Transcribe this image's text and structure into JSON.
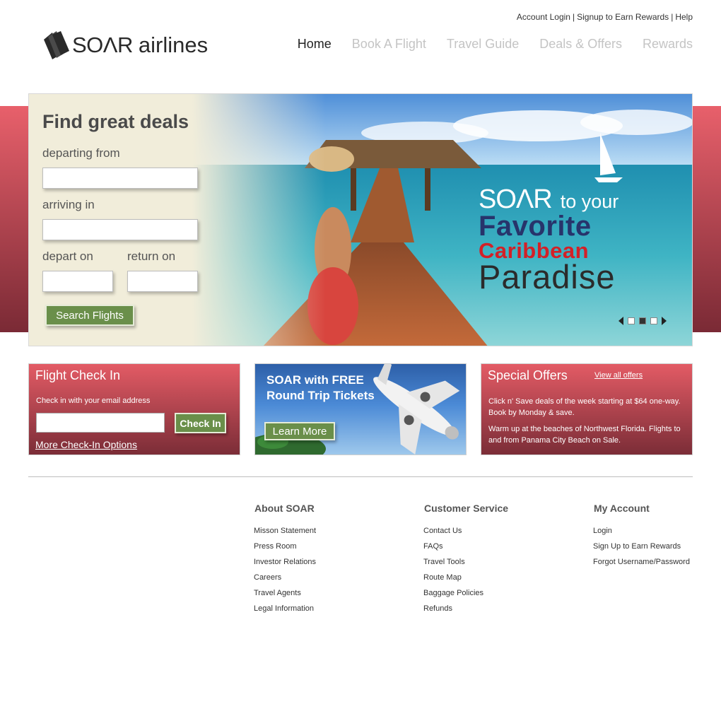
{
  "header": {
    "top_links": [
      "Account Login",
      "Signup to Earn Rewards",
      "Help"
    ],
    "logo": {
      "soar": "SOΛR",
      "airlines": "airlines"
    },
    "nav": [
      "Home",
      "Book A Flight",
      "Travel Guide",
      "Deals & Offers",
      "Rewards"
    ],
    "active_nav": "Home"
  },
  "search": {
    "title": "Find great deals",
    "departing_label": "departing from",
    "departing_value": "",
    "arriving_label": "arriving in",
    "arriving_value": "",
    "depart_label": "depart on",
    "depart_value": "",
    "return_label": "return on",
    "return_value": "",
    "button": "Search Flights"
  },
  "hero": {
    "slogan_soar": "SOΛR",
    "slogan_line1": "to your",
    "slogan_line2": "Favorite",
    "slogan_line3": "Caribbean",
    "slogan_line4": "Paradise",
    "slide_count": 3,
    "active_slide": 2
  },
  "checkin": {
    "title": "Flight Check In",
    "note": "Check in with your email address",
    "email_value": "",
    "button": "Check In",
    "more_link": "More Check-In Options"
  },
  "promo": {
    "title_line1": "SOAR with FREE",
    "title_line2": "Round Trip Tickets",
    "button": "Learn More"
  },
  "offers": {
    "title": "Special Offers",
    "view_all": "View all offers",
    "items": [
      "Click n' Save deals of the week starting at $64 one-way. Book by Monday & save.",
      "Warm up at the beaches of Northwest Florida. Flights to and from Panama City Beach on Sale."
    ]
  },
  "footer": {
    "about": {
      "title": "About SOAR",
      "links": [
        "Misson Statement",
        "Press Room",
        "Investor Relations",
        "Careers",
        "Travel Agents",
        "Legal Information"
      ]
    },
    "service": {
      "title": "Customer Service",
      "links": [
        "Contact Us",
        "FAQs",
        "Travel Tools",
        "Route Map",
        "Baggage Policies",
        "Refunds"
      ]
    },
    "account": {
      "title": "My Account",
      "links": [
        "Login",
        "Sign Up to Earn Rewards",
        "Forgot Username/Password"
      ]
    }
  },
  "colors": {
    "accent_red": "#e35b65",
    "dark_red": "#7b2d37",
    "button_green": "#6a8f4a",
    "slogan_blue": "#27346b",
    "slogan_red": "#d32027"
  }
}
